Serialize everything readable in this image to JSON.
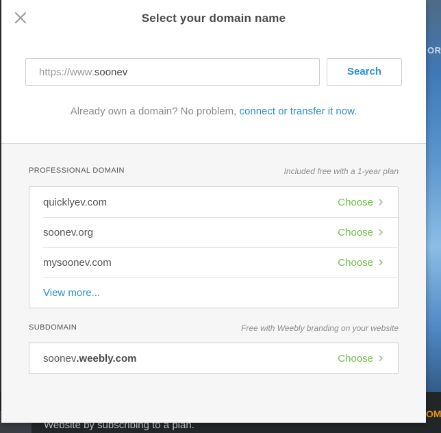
{
  "background": {
    "right_text": "ORK",
    "bottom_text": "Website by subscribing to a plan.",
    "bottom_right_text": "OM"
  },
  "modal": {
    "title": "Select your domain name",
    "search": {
      "prefix": "https://www.",
      "value": "soonev",
      "button_label": "Search"
    },
    "own_domain": {
      "text": "Already own a domain? No problem, ",
      "link": "connect or transfer it now."
    },
    "professional": {
      "label": "PROFESSIONAL DOMAIN",
      "note": "Included free with a 1-year plan",
      "items": [
        {
          "domain": "quicklyev.com",
          "action": "Choose"
        },
        {
          "domain": "soonev.org",
          "action": "Choose"
        },
        {
          "domain": "mysoonev.com",
          "action": "Choose"
        }
      ],
      "view_more": "View more..."
    },
    "subdomain": {
      "label": "SUBDOMAIN",
      "note": "Free with Weebly branding on your website",
      "name": "soonev",
      "suffix": ".weebly.com",
      "action": "Choose"
    }
  },
  "colors": {
    "accent_blue": "#2a8fd4",
    "choose_green": "#6fbe49"
  },
  "icons": {
    "close": "close-icon",
    "chevron": "chevron-right-icon"
  }
}
